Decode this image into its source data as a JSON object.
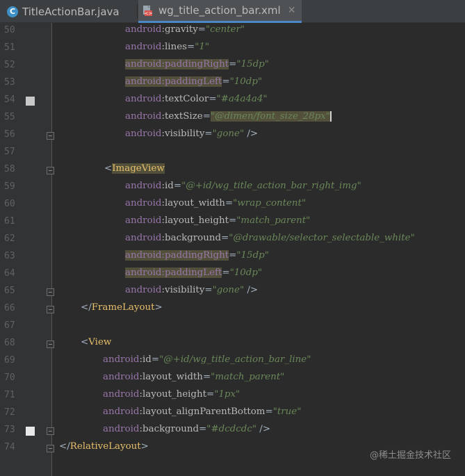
{
  "tabs": [
    {
      "label": "TitleActionBar.java",
      "icon": "java-class-icon",
      "active": false
    },
    {
      "label": "wg_title_action_bar.xml",
      "icon": "xml-file-icon",
      "active": true
    }
  ],
  "lines": [
    {
      "num": "50",
      "indent": 1,
      "tokens": [
        {
          "t": "android",
          "c": "ns"
        },
        {
          "t": ":gravity",
          "c": "attr"
        },
        {
          "t": "=",
          "c": "eq"
        },
        {
          "t": "\"center\"",
          "c": "val"
        }
      ]
    },
    {
      "num": "51",
      "indent": 1,
      "tokens": [
        {
          "t": "android",
          "c": "ns"
        },
        {
          "t": ":lines",
          "c": "attr"
        },
        {
          "t": "=",
          "c": "eq"
        },
        {
          "t": "\"1\"",
          "c": "val"
        }
      ]
    },
    {
      "num": "52",
      "indent": 1,
      "tokens": [
        {
          "t": "android:paddingRight",
          "c": "ns hl"
        },
        {
          "t": "=",
          "c": "eq"
        },
        {
          "t": "\"15dp\"",
          "c": "val"
        }
      ]
    },
    {
      "num": "53",
      "indent": 1,
      "tokens": [
        {
          "t": "android:paddingLeft",
          "c": "ns hl"
        },
        {
          "t": "=",
          "c": "eq"
        },
        {
          "t": "\"10dp\"",
          "c": "val"
        }
      ]
    },
    {
      "num": "54",
      "indent": 1,
      "bookmark": true,
      "tokens": [
        {
          "t": "android",
          "c": "ns"
        },
        {
          "t": ":textColor",
          "c": "attr"
        },
        {
          "t": "=",
          "c": "eq"
        },
        {
          "t": "\"#a4a4a4\"",
          "c": "val"
        }
      ]
    },
    {
      "num": "55",
      "indent": 1,
      "tokens": [
        {
          "t": "android",
          "c": "ns"
        },
        {
          "t": ":textSize",
          "c": "attr"
        },
        {
          "t": "=",
          "c": "eq"
        },
        {
          "t": "\"@dimen/font_size_28px\"",
          "c": "val hl caret"
        }
      ]
    },
    {
      "num": "56",
      "indent": 1,
      "fold": true,
      "tokens": [
        {
          "t": "android",
          "c": "ns"
        },
        {
          "t": ":visibility",
          "c": "attr"
        },
        {
          "t": "=",
          "c": "eq"
        },
        {
          "t": "\"gone\"",
          "c": "val"
        },
        {
          "t": " />",
          "c": "eq"
        }
      ]
    },
    {
      "num": "57",
      "indent": 0,
      "tokens": []
    },
    {
      "num": "58",
      "indent": 2,
      "fold": true,
      "tokens": [
        {
          "t": "<",
          "c": "eq"
        },
        {
          "t": "ImageView",
          "c": "tag hl"
        }
      ]
    },
    {
      "num": "59",
      "indent": 1,
      "tokens": [
        {
          "t": "android",
          "c": "ns"
        },
        {
          "t": ":id",
          "c": "attr"
        },
        {
          "t": "=",
          "c": "eq"
        },
        {
          "t": "\"@+id/wg_title_action_bar_right_img\"",
          "c": "val"
        }
      ]
    },
    {
      "num": "60",
      "indent": 1,
      "tokens": [
        {
          "t": "android",
          "c": "ns"
        },
        {
          "t": ":layout_width",
          "c": "attr"
        },
        {
          "t": "=",
          "c": "eq"
        },
        {
          "t": "\"wrap_content\"",
          "c": "val"
        }
      ]
    },
    {
      "num": "61",
      "indent": 1,
      "tokens": [
        {
          "t": "android",
          "c": "ns"
        },
        {
          "t": ":layout_height",
          "c": "attr"
        },
        {
          "t": "=",
          "c": "eq"
        },
        {
          "t": "\"match_parent\"",
          "c": "val"
        }
      ]
    },
    {
      "num": "62",
      "indent": 1,
      "tokens": [
        {
          "t": "android",
          "c": "ns"
        },
        {
          "t": ":background",
          "c": "attr"
        },
        {
          "t": "=",
          "c": "eq"
        },
        {
          "t": "\"@drawable/selector_selectable_white\"",
          "c": "val"
        }
      ]
    },
    {
      "num": "63",
      "indent": 1,
      "tokens": [
        {
          "t": "android:paddingRight",
          "c": "ns hl"
        },
        {
          "t": "=",
          "c": "eq"
        },
        {
          "t": "\"15dp\"",
          "c": "val"
        }
      ]
    },
    {
      "num": "64",
      "indent": 1,
      "tokens": [
        {
          "t": "android:paddingLeft",
          "c": "ns hl"
        },
        {
          "t": "=",
          "c": "eq"
        },
        {
          "t": "\"10dp\"",
          "c": "val"
        }
      ]
    },
    {
      "num": "65",
      "indent": 1,
      "fold": true,
      "tokens": [
        {
          "t": "android",
          "c": "ns"
        },
        {
          "t": ":visibility",
          "c": "attr"
        },
        {
          "t": "=",
          "c": "eq"
        },
        {
          "t": "\"gone\"",
          "c": "val"
        },
        {
          "t": " />",
          "c": "eq"
        }
      ]
    },
    {
      "num": "66",
      "indent": 3,
      "fold": true,
      "tokens": [
        {
          "t": "</",
          "c": "eq"
        },
        {
          "t": "FrameLayout",
          "c": "tag"
        },
        {
          "t": ">",
          "c": "eq"
        }
      ]
    },
    {
      "num": "67",
      "indent": 0,
      "tokens": []
    },
    {
      "num": "68",
      "indent": 3,
      "fold": true,
      "tokens": [
        {
          "t": "<",
          "c": "eq"
        },
        {
          "t": "View",
          "c": "tag"
        }
      ]
    },
    {
      "num": "69",
      "indent": 4,
      "tokens": [
        {
          "t": "android",
          "c": "ns"
        },
        {
          "t": ":id",
          "c": "attr"
        },
        {
          "t": "=",
          "c": "eq"
        },
        {
          "t": "\"@+id/wg_title_action_bar_line\"",
          "c": "val"
        }
      ]
    },
    {
      "num": "70",
      "indent": 4,
      "tokens": [
        {
          "t": "android",
          "c": "ns"
        },
        {
          "t": ":layout_width",
          "c": "attr"
        },
        {
          "t": "=",
          "c": "eq"
        },
        {
          "t": "\"match_parent\"",
          "c": "val"
        }
      ]
    },
    {
      "num": "71",
      "indent": 4,
      "tokens": [
        {
          "t": "android",
          "c": "ns"
        },
        {
          "t": ":layout_height",
          "c": "attr"
        },
        {
          "t": "=",
          "c": "eq"
        },
        {
          "t": "\"1px\"",
          "c": "val"
        }
      ]
    },
    {
      "num": "72",
      "indent": 4,
      "tokens": [
        {
          "t": "android",
          "c": "ns"
        },
        {
          "t": ":layout_alignParentBottom",
          "c": "attr"
        },
        {
          "t": "=",
          "c": "eq"
        },
        {
          "t": "\"true\"",
          "c": "val"
        }
      ]
    },
    {
      "num": "73",
      "indent": 4,
      "bookmark_white": true,
      "fold": true,
      "tokens": [
        {
          "t": "android",
          "c": "ns"
        },
        {
          "t": ":background",
          "c": "attr"
        },
        {
          "t": "=",
          "c": "eq"
        },
        {
          "t": "\"#dcdcdc\"",
          "c": "val"
        },
        {
          "t": " />",
          "c": "eq"
        }
      ]
    },
    {
      "num": "74",
      "indent": 5,
      "fold": true,
      "tokens": [
        {
          "t": "</",
          "c": "eq"
        },
        {
          "t": "RelativeLayout",
          "c": "tag"
        },
        {
          "t": ">",
          "c": "eq"
        }
      ]
    }
  ],
  "watermark": "@稀土掘金技术社区"
}
